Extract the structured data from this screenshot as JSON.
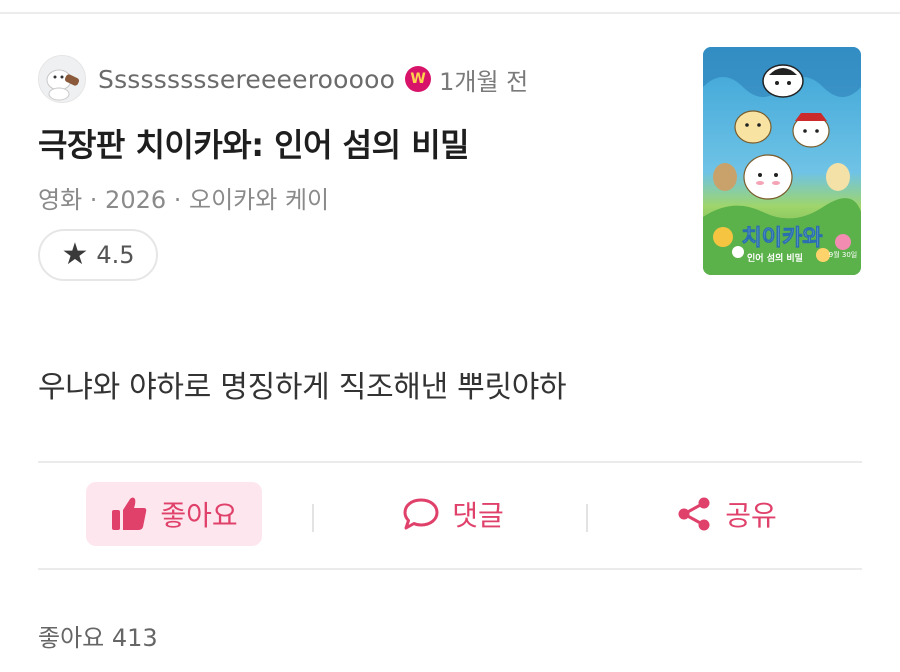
{
  "post": {
    "author": "Sssssssssereeeerooooo",
    "time_ago": "1개월 전",
    "badge_letter": "W",
    "title": "극장판 치이카와: 인어 섬의 비밀",
    "meta": "영화 · 2026 · 오이카와 케이",
    "rating": "4.5",
    "body": "우냐와 야하로 명징하게 직조해낸 뿌릿야하",
    "likes_label": "좋아요 413"
  },
  "poster": {
    "title_text": "치이카와",
    "subtitle_text": "인어 섬의 비밀",
    "date_text": "9월 30일"
  },
  "actions": {
    "like_label": "좋아요",
    "comment_label": "댓글",
    "share_label": "공유"
  },
  "colors": {
    "accent": "#e0416b",
    "accent_bg": "#fde6ed",
    "badge": "#d8136a"
  }
}
